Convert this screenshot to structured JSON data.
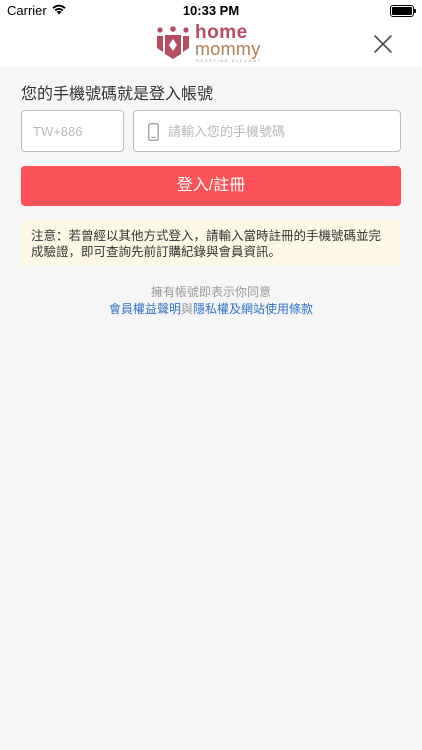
{
  "status_bar": {
    "carrier": "Carrier",
    "time": "10:33 PM"
  },
  "header": {
    "logo": {
      "word1": "home",
      "word2": "mommy",
      "tagline": "REDEFINE ELEGANT"
    },
    "close_icon": "close-icon"
  },
  "login": {
    "title": "您的手機號碼就是登入帳號",
    "country_code": "TW+886",
    "phone_placeholder": "請輸入您的手機號碼",
    "phone_value": "",
    "submit_label": "登入/註冊"
  },
  "notice": {
    "text": "注意：若曾經以其他方式登入，請輸入當時註冊的手機號碼並完成驗證，即可查詢先前訂購紀錄與會員資訊。"
  },
  "terms": {
    "intro": "擁有帳號即表示你同意",
    "member_rights_link": "會員權益聲明",
    "connector": "與",
    "privacy_link": "隱私權及網站使用條款"
  },
  "colors": {
    "accent": "#fb5257",
    "notice_bg": "#fcf8e3",
    "link": "#2f72c9",
    "logo_home": "#b64d63",
    "logo_mommy": "#b07f55"
  }
}
